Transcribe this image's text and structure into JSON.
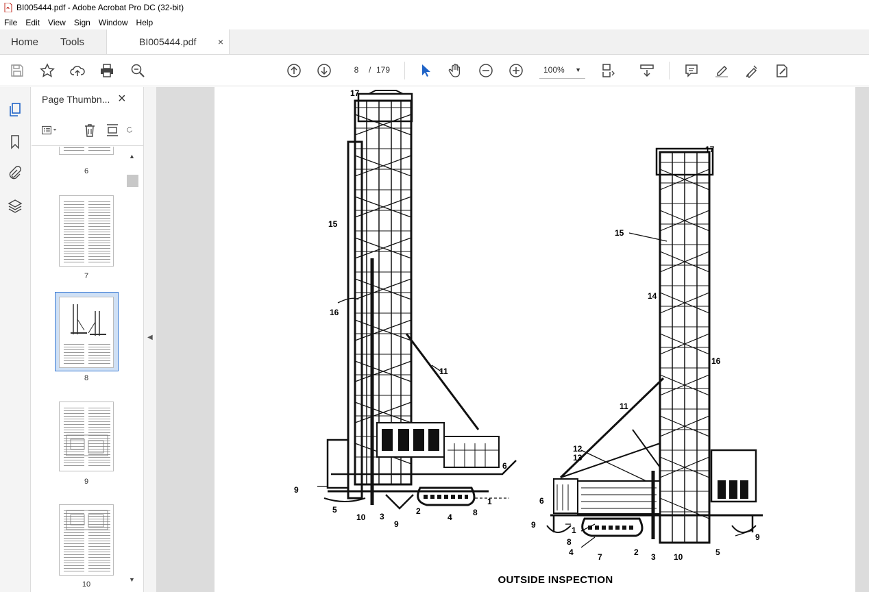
{
  "window": {
    "title": "BI005444.pdf - Adobe Acrobat Pro DC (32-bit)"
  },
  "menu": {
    "items": [
      "File",
      "Edit",
      "View",
      "Sign",
      "Window",
      "Help"
    ]
  },
  "tabs": {
    "home": "Home",
    "tools": "Tools",
    "document": "BI005444.pdf",
    "close_glyph": "×"
  },
  "toolbar": {
    "current_page": "8",
    "page_separator": "/",
    "total_pages": "179",
    "zoom": "100%"
  },
  "panel": {
    "title": "Page Thumbn...",
    "close_glyph": "×",
    "thumbnails": [
      {
        "label": "6"
      },
      {
        "label": "7"
      },
      {
        "label": "8",
        "selected": true
      },
      {
        "label": "9"
      },
      {
        "label": "10"
      }
    ]
  },
  "document": {
    "caption": "OUTSIDE INSPECTION",
    "callouts_left": [
      "17",
      "15",
      "16",
      "11",
      "6",
      "9",
      "5",
      "10",
      "3",
      "2",
      "9",
      "4",
      "8",
      "1"
    ],
    "callouts_right": [
      "17",
      "15",
      "14",
      "16",
      "11",
      "12",
      "13",
      "6",
      "9",
      "1",
      "8",
      "4",
      "7",
      "2",
      "3",
      "10",
      "5",
      "9"
    ]
  },
  "colors": {
    "accent": "#3b7bd4",
    "app_red": "#c0281e",
    "canvas_bg": "#dcdcdc"
  }
}
